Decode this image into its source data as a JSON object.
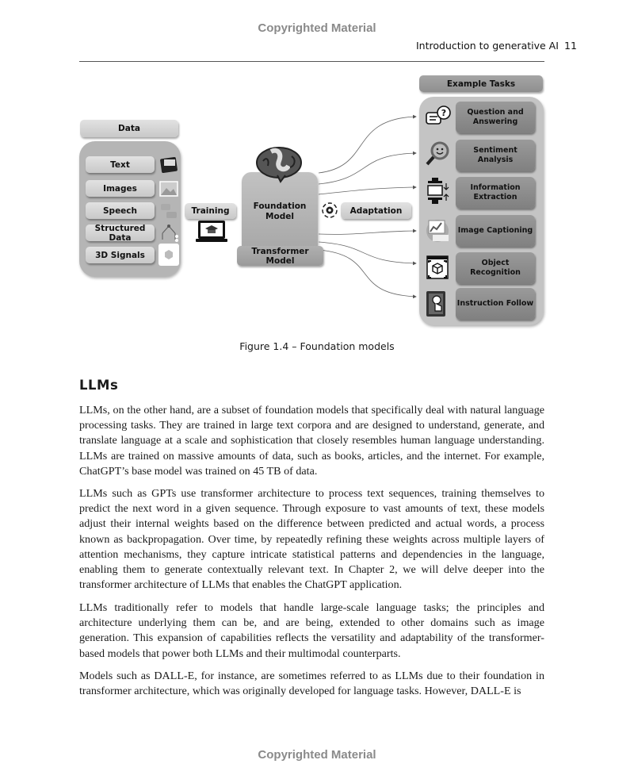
{
  "page": {
    "watermark_top": "Copyrighted Material",
    "watermark_bottom": "Copyrighted Material",
    "running_head": "Introduction to generative AI",
    "page_number": "11"
  },
  "figure": {
    "data_header": "Data",
    "data_items": [
      "Text",
      "Images",
      "Speech",
      "Structured Data",
      "3D Signals"
    ],
    "training_label": "Training",
    "foundation_label": "Foundation Model",
    "transformer_label": "Transformer Model",
    "adaptation_label": "Adaptation",
    "tasks_header": "Example Tasks",
    "tasks": [
      {
        "label": "Question and Answering",
        "icon": "question-chat-icon"
      },
      {
        "label": "Sentiment Analysis",
        "icon": "magnifier-smiley-icon"
      },
      {
        "label": "Information Extraction",
        "icon": "folder-press-icon"
      },
      {
        "label": "Image Captioning",
        "icon": "image-chart-icon"
      },
      {
        "label": "Object Recognition",
        "icon": "cube-scan-icon"
      },
      {
        "label": "Instruction Follow",
        "icon": "hand-gear-icon"
      }
    ],
    "caption": "Figure 1.4 – Foundation models"
  },
  "section": {
    "heading": "LLMs",
    "paragraphs": [
      "LLMs, on the other hand, are a subset of foundation models that specifically deal with natural language processing tasks. They are trained in large text corpora and are designed to understand, generate, and translate language at a scale and sophistication that closely resembles human language understanding. LLMs are trained on massive amounts of data, such as books, articles, and the internet. For example, ChatGPT’s base model was trained on 45 TB of data.",
      "LLMs such as GPTs use transformer architecture to process text sequences, training themselves to predict the next word in a given sequence. Through exposure to vast amounts of text, these models adjust their internal weights based on the difference between predicted and actual words, a process known as backpropagation. Over time, by repeatedly refining these weights across multiple layers of attention mechanisms, they capture intricate statistical patterns and dependencies in the language, enabling them to generate contextually relevant text. In Chapter 2, we will delve deeper into the transformer architecture of LLMs that enables the ChatGPT application.",
      "LLMs traditionally refer to models that handle large-scale language tasks; the principles and architecture underlying them can be, and are being, extended to other domains such as image generation. This expansion of capabilities reflects the versatility and adaptability of the transformer-based models that power both LLMs and their multimodal counterparts.",
      "Models such as DALL-E, for instance, are sometimes referred to as LLMs due to their foundation in transformer architecture, which was originally developed for language tasks. However, DALL-E is"
    ]
  }
}
